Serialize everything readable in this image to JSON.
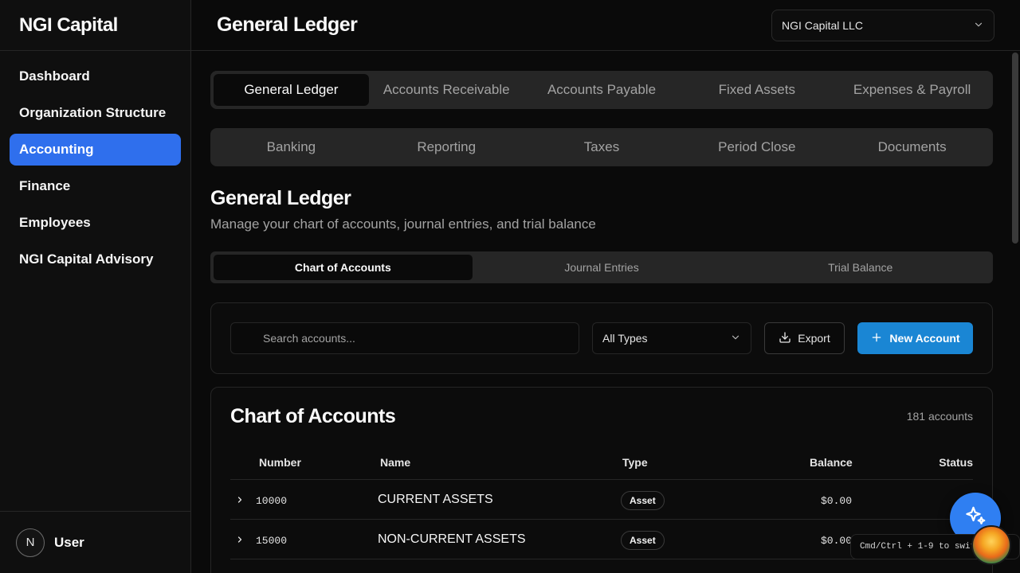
{
  "app": {
    "brand": "NGI Capital"
  },
  "sidebar": {
    "items": [
      {
        "label": "Dashboard"
      },
      {
        "label": "Organization Structure"
      },
      {
        "label": "Accounting",
        "active": true
      },
      {
        "label": "Finance"
      },
      {
        "label": "Employees"
      },
      {
        "label": "NGI Capital Advisory"
      }
    ],
    "user": {
      "initial": "N",
      "name": "User"
    }
  },
  "header": {
    "title": "General Ledger",
    "entity_select": {
      "value": "NGI Capital LLC"
    }
  },
  "tabs_primary": [
    {
      "label": "General Ledger",
      "active": true
    },
    {
      "label": "Accounts Receivable"
    },
    {
      "label": "Accounts Payable"
    },
    {
      "label": "Fixed Assets"
    },
    {
      "label": "Expenses & Payroll"
    }
  ],
  "tabs_secondary": [
    {
      "label": "Banking"
    },
    {
      "label": "Reporting"
    },
    {
      "label": "Taxes"
    },
    {
      "label": "Period Close"
    },
    {
      "label": "Documents"
    }
  ],
  "section": {
    "title": "General Ledger",
    "subtitle": "Manage your chart of accounts, journal entries, and trial balance"
  },
  "subtabs": [
    {
      "label": "Chart of Accounts",
      "active": true
    },
    {
      "label": "Journal Entries"
    },
    {
      "label": "Trial Balance"
    }
  ],
  "filters": {
    "search_placeholder": "Search accounts...",
    "type_select": "All Types",
    "export_label": "Export",
    "new_account_label": "New Account"
  },
  "table": {
    "title": "Chart of Accounts",
    "count": "181 accounts",
    "columns": {
      "number": "Number",
      "name": "Name",
      "type": "Type",
      "balance": "Balance",
      "status": "Status"
    },
    "rows": [
      {
        "number": "10000",
        "name": "CURRENT ASSETS",
        "type": "Asset",
        "balance": "$0.00"
      },
      {
        "number": "15000",
        "name": "NON-CURRENT ASSETS",
        "type": "Asset",
        "balance": "$0.00"
      }
    ]
  },
  "hint": "Cmd/Ctrl + 1-9 to switch",
  "icons": {
    "chevron": "chevron-down-icon",
    "search": "search-icon",
    "download": "download-icon",
    "plus": "plus-icon",
    "sparkles": "sparkles-icon"
  },
  "colors": {
    "accent": "#2f6fed",
    "primary_button": "#1a86d4",
    "background": "#0a0a0a"
  }
}
